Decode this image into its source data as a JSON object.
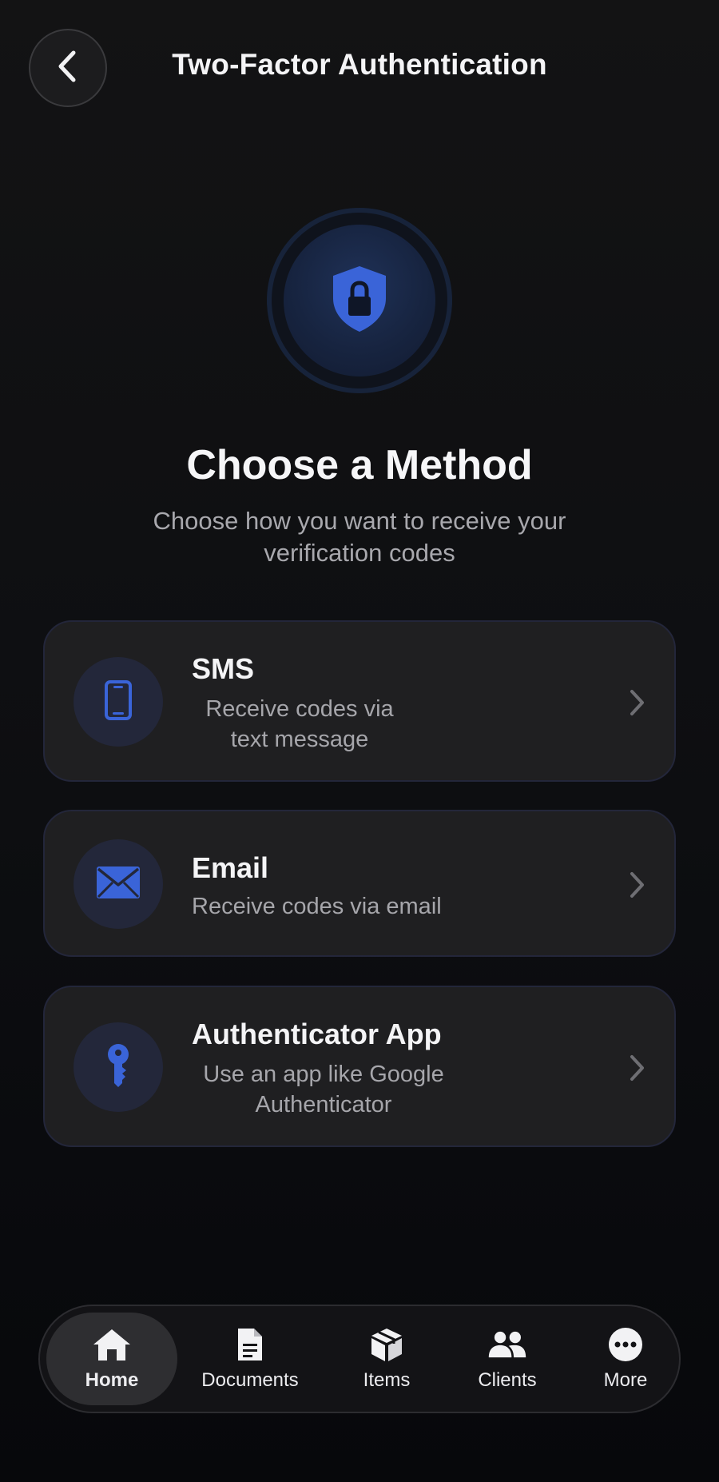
{
  "header": {
    "title": "Two-Factor Authentication",
    "back_icon": "chevron-left-icon"
  },
  "hero": {
    "icon": "shield-lock-icon",
    "title": "Choose a Method",
    "subtitle": "Choose how you want to receive your verification codes"
  },
  "methods": [
    {
      "id": "sms",
      "icon": "phone-icon",
      "title": "SMS",
      "description": "Receive codes via text message"
    },
    {
      "id": "email",
      "icon": "mail-icon",
      "title": "Email",
      "description": "Receive codes via email"
    },
    {
      "id": "authenticator",
      "icon": "key-icon",
      "title": "Authenticator App",
      "description": "Use an app like Google Authenticator"
    }
  ],
  "tabbar": {
    "active": "Home",
    "tabs": [
      {
        "label": "Home",
        "icon": "home-icon"
      },
      {
        "label": "Documents",
        "icon": "document-icon"
      },
      {
        "label": "Items",
        "icon": "box-icon"
      },
      {
        "label": "Clients",
        "icon": "people-icon"
      },
      {
        "label": "More",
        "icon": "more-icon"
      }
    ]
  },
  "colors": {
    "accent": "#3a64d8",
    "background": "#121214",
    "card": "#1f1f21",
    "icon_bg": "#23273a"
  }
}
